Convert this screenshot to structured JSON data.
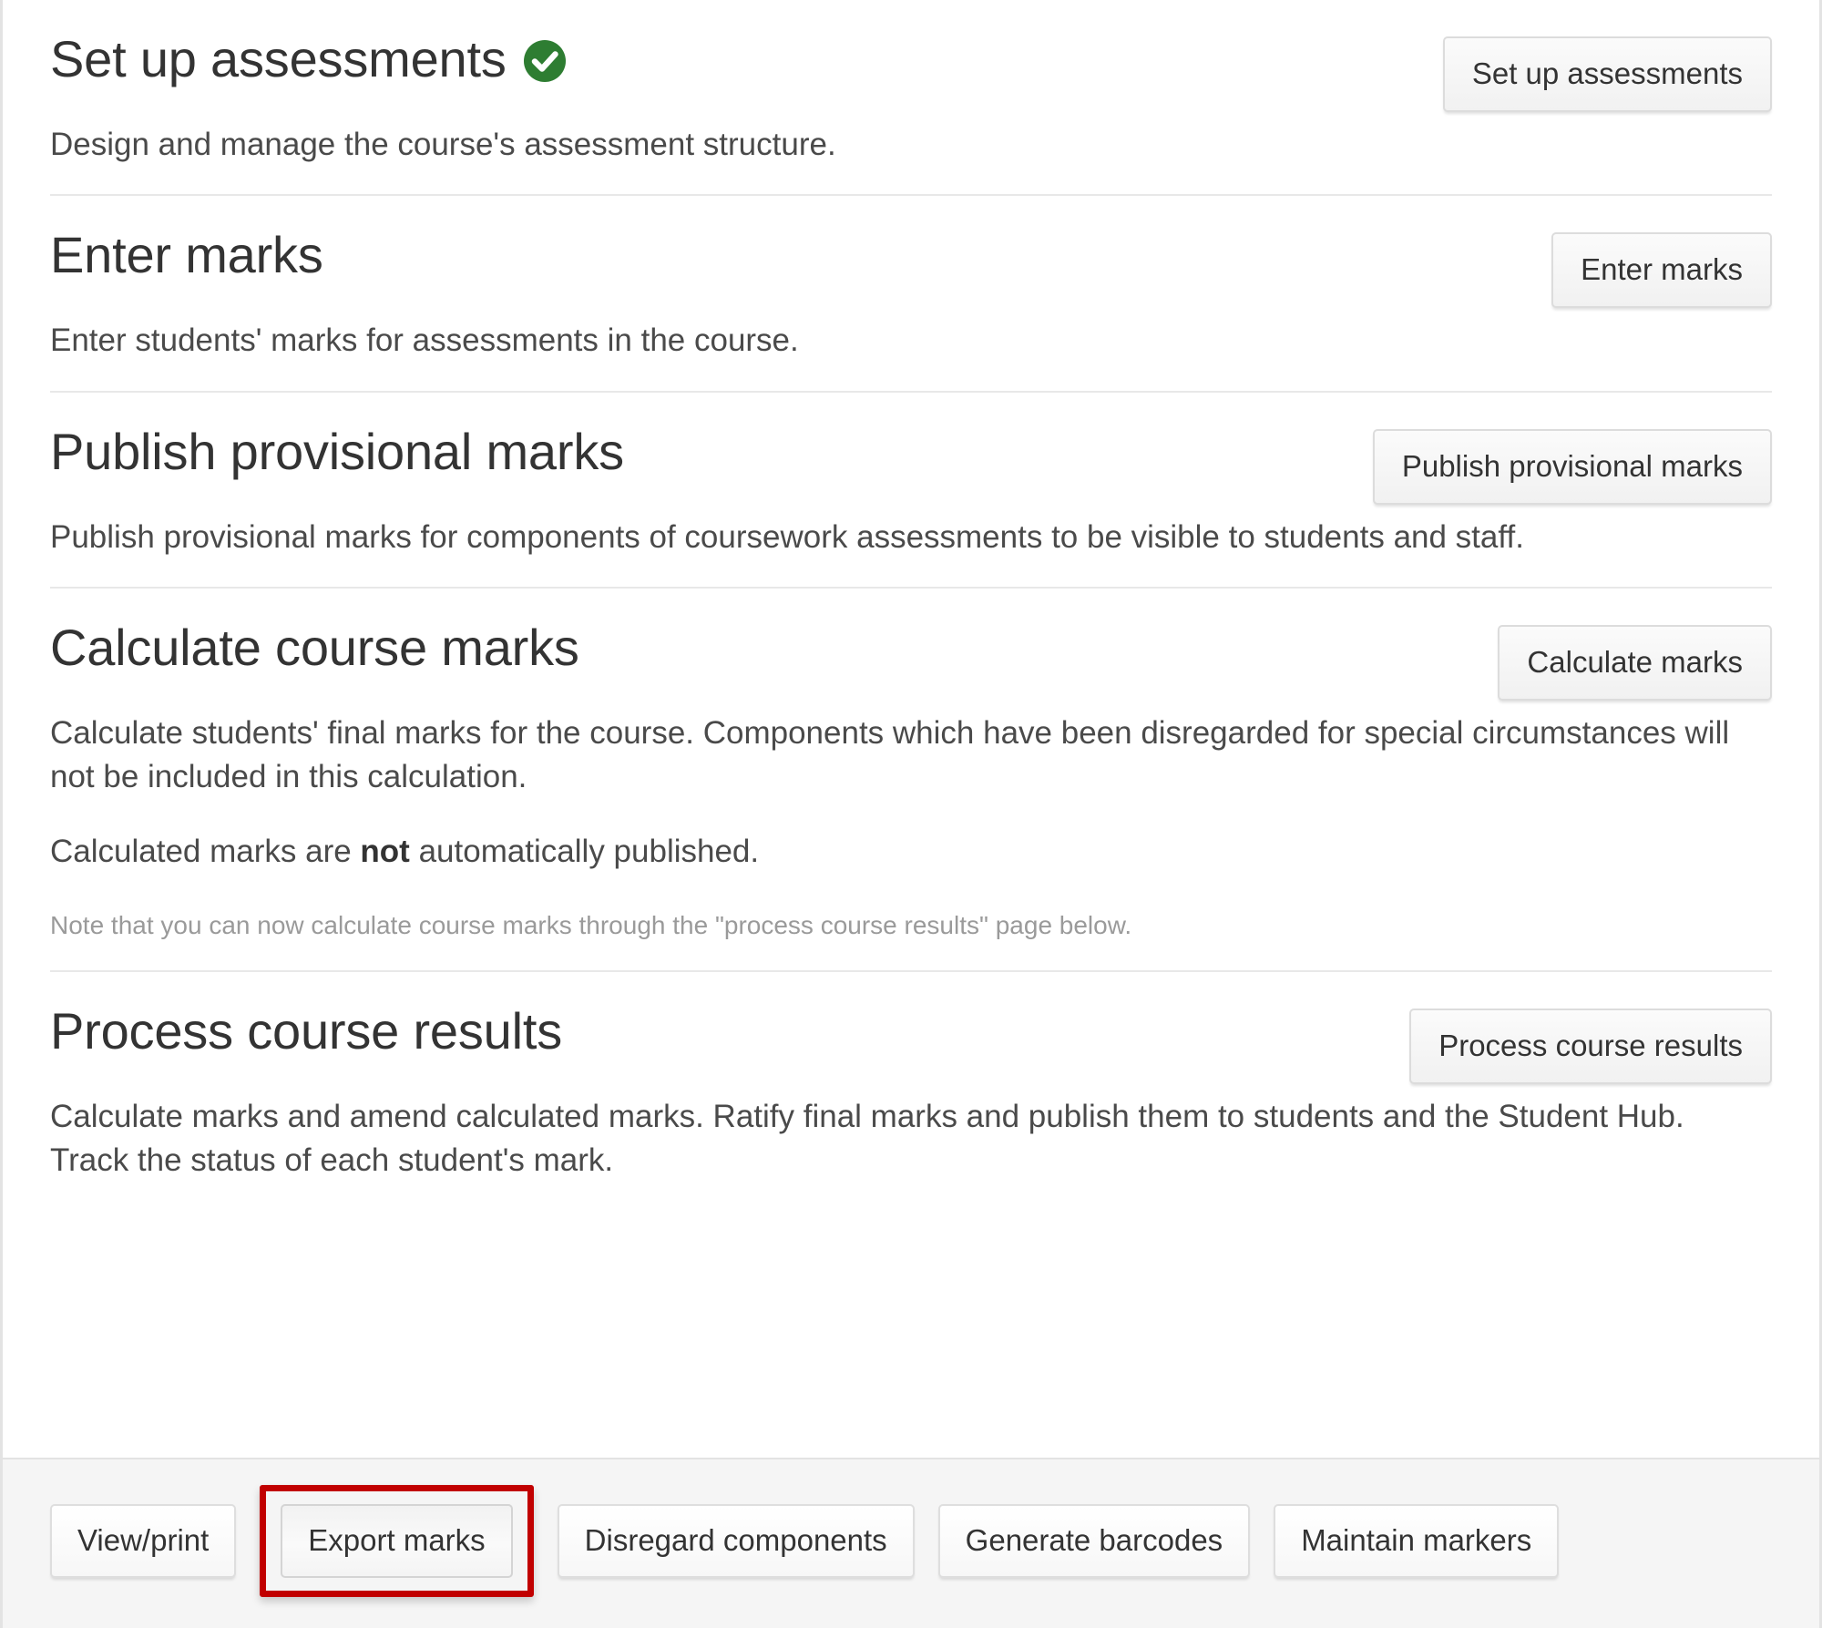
{
  "colors": {
    "highlight": "#c10000",
    "tick_green": "#2e7d32",
    "text": "#333333",
    "muted": "#9a9a9a"
  },
  "sections": [
    {
      "title": "Set up assessments",
      "status_icon": "check-circle-icon",
      "has_status_icon": true,
      "button_label": "Set up assessments",
      "paragraphs": [
        "Design and manage the course's assessment structure."
      ],
      "note": null
    },
    {
      "title": "Enter marks",
      "status_icon": null,
      "has_status_icon": false,
      "button_label": "Enter marks",
      "paragraphs": [
        "Enter students' marks for assessments in the course."
      ],
      "note": null
    },
    {
      "title": "Publish provisional marks",
      "status_icon": null,
      "has_status_icon": false,
      "button_label": "Publish provisional marks",
      "paragraphs": [
        "Publish provisional marks for components of coursework assessments to be visible to students and staff."
      ],
      "note": null
    },
    {
      "title": "Calculate course marks",
      "status_icon": null,
      "has_status_icon": false,
      "button_label": "Calculate marks",
      "paragraphs_rich": [
        {
          "pre": "Calculate students' final marks for the course. Components which have been disregarded for special circumstances will not be included in this calculation.",
          "bold": "",
          "post": ""
        },
        {
          "pre": "Calculated marks are ",
          "bold": "not",
          "post": " automatically published."
        }
      ],
      "note": "Note that you can now calculate course marks through the \"process course results\" page below."
    },
    {
      "title": "Process course results",
      "status_icon": null,
      "has_status_icon": false,
      "button_label": "Process course results",
      "paragraphs": [
        "Calculate marks and amend calculated marks. Ratify final marks and publish them to students and the Student Hub. Track the status of each student's mark."
      ],
      "note": null
    }
  ],
  "footer": {
    "buttons": [
      {
        "label": "View/print",
        "highlighted": false
      },
      {
        "label": "Export marks",
        "highlighted": true
      },
      {
        "label": "Disregard components",
        "highlighted": false
      },
      {
        "label": "Generate barcodes",
        "highlighted": false
      },
      {
        "label": "Maintain markers",
        "highlighted": false
      }
    ]
  }
}
